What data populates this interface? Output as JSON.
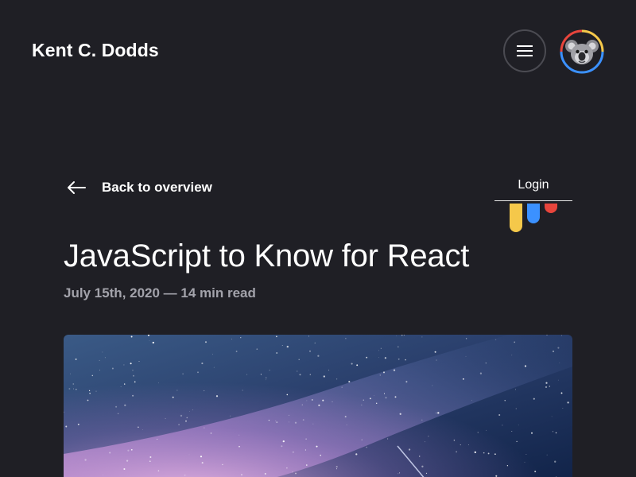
{
  "header": {
    "site_title": "Kent C. Dodds",
    "menu_icon": "menu-icon",
    "avatar_icon": "koala-avatar",
    "avatar_ring_colors": [
      "#f5c84a",
      "#e8453c",
      "#3b91ff"
    ]
  },
  "article": {
    "back_label": "Back to overview",
    "back_icon": "arrow-left-icon",
    "login_label": "Login",
    "title": "JavaScript to Know for React",
    "meta": "July 15th, 2020 — 14 min read",
    "hero_alt": "starry night sky with milky way"
  },
  "colors": {
    "background": "#1f1f25",
    "text": "#ffffff",
    "muted": "#a3a3ab",
    "yellow": "#f5c84a",
    "blue": "#3b91ff",
    "red": "#e8453c"
  }
}
